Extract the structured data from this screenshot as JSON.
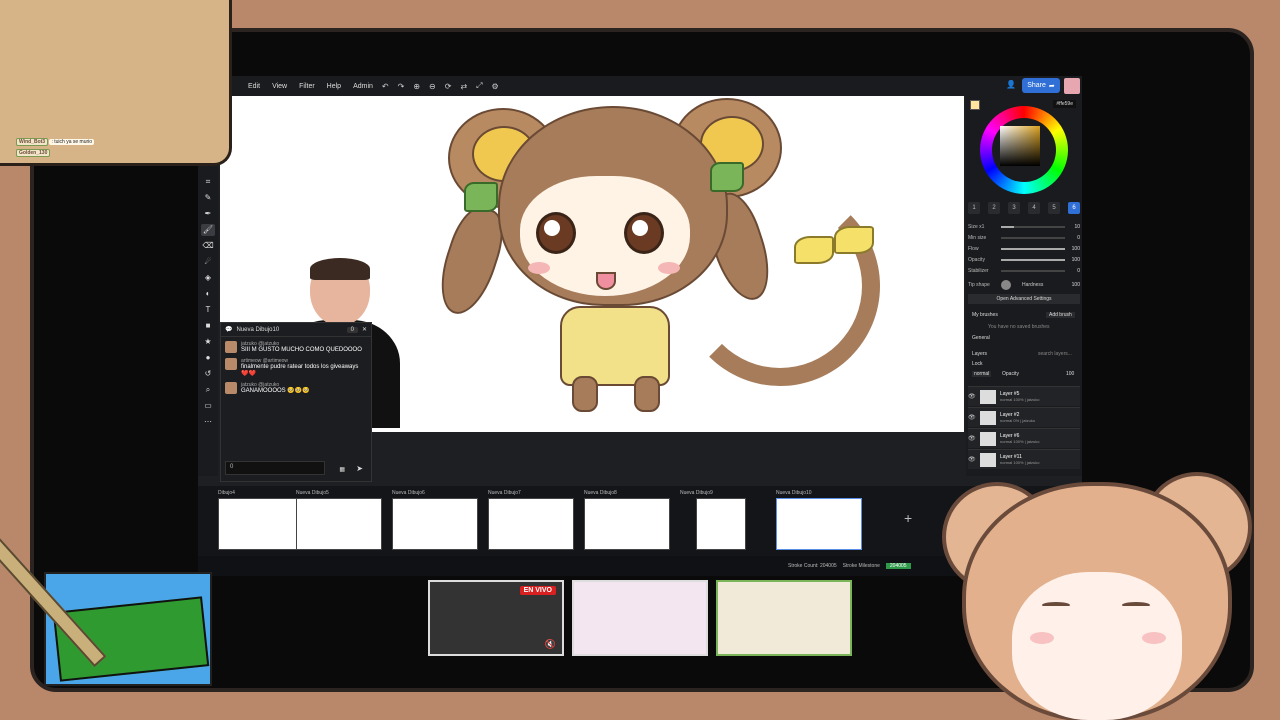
{
  "overlay_chat": {
    "line1_user": "Wind_Bot3",
    "line1_msg": ": tuich ya se murio",
    "line2_user": "Golden_130"
  },
  "menubar": {
    "items": [
      "Edit",
      "View",
      "Filter",
      "Help",
      "Admin"
    ],
    "share_label": "Share"
  },
  "chat_panel": {
    "title": "Nueva Dibujo10",
    "count": "0",
    "messages": [
      {
        "user": "jatzuko @jatzuko",
        "text": "SIII M GUSTO MUCHO COMO QUEDOOOO"
      },
      {
        "user": "artimeow @artimeow",
        "text": "finalmente pudre ratear todos los giveaways ❤️❤️"
      },
      {
        "user": "jatzuko @jatzuko",
        "text": "GANAMOOOOS 🥺🥺🥺"
      }
    ],
    "input_value": "0"
  },
  "right_panel": {
    "hex": "#ffe59e",
    "brush_numbers": [
      "1",
      "2",
      "3",
      "4",
      "5",
      "6"
    ],
    "props": [
      {
        "label": "Size x1",
        "value": "10",
        "fill": 0.2
      },
      {
        "label": "Min size",
        "value": "0",
        "fill": 0
      },
      {
        "label": "Flow",
        "value": "100",
        "fill": 1
      },
      {
        "label": "Opacity",
        "value": "100",
        "fill": 1
      },
      {
        "label": "Stabilizer",
        "value": "0",
        "fill": 0
      }
    ],
    "tip_shape": "Tip shape",
    "hardness_label": "Hardness",
    "hardness_value": "100",
    "advanced_btn": "Open Advanced Settings",
    "my_brushes": "My brushes",
    "add_brush": "Add brush",
    "no_brushes": "You have no saved brushes",
    "general": "General",
    "layers_label": "Layers",
    "search_layers": "search layers...",
    "lock_label": "Lock",
    "blend_mode": "normal",
    "opacity_label": "Opacity",
    "opacity_value": "100",
    "layers": [
      {
        "name": "Layer #5",
        "sub": "normal 100% | jatzuko"
      },
      {
        "name": "Layer #2",
        "sub": "normal 0% | jatzuko"
      },
      {
        "name": "Layer #6",
        "sub": "normal 100% | jatzuko"
      },
      {
        "name": "Layer #11",
        "sub": "normal 100% | jatzuko"
      }
    ]
  },
  "tabs": [
    {
      "label": "Dibujo4"
    },
    {
      "label": "Nueva Dibujo5"
    },
    {
      "label": "Nueva Dibujo6"
    },
    {
      "label": "Nueva Dibujo7"
    },
    {
      "label": "Nueva Dibujo8"
    },
    {
      "label": "Nueva Dibujo9"
    },
    {
      "label": "Nueva Dibujo10"
    }
  ],
  "status": {
    "stroke_count": "Stroke Count: 204005",
    "milestone_label": "Stroke Milestone",
    "milestone_value": "204005"
  },
  "live_badge": "EN VIVO",
  "colors": {
    "accent": "#2f6fd6",
    "live": "#d92020",
    "milestone": "#2f9a4a",
    "frame": "#b9876a"
  }
}
